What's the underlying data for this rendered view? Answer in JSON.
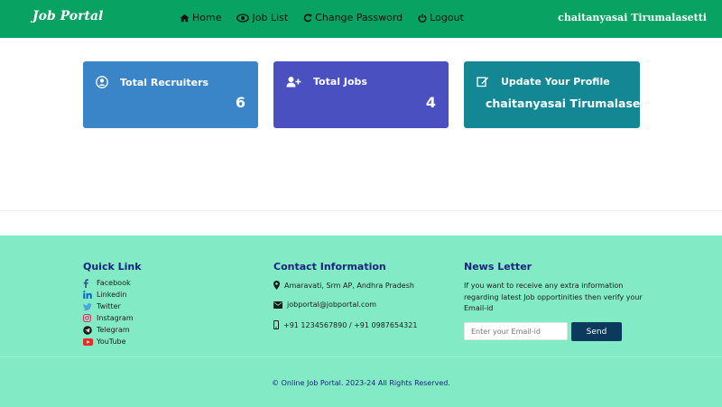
{
  "header": {
    "brand": "Job Portal",
    "nav": [
      {
        "label": "Home",
        "icon": "home-icon"
      },
      {
        "label": "Job List",
        "icon": "eye-icon"
      },
      {
        "label": "Change Password",
        "icon": "refresh-icon"
      },
      {
        "label": "Logout",
        "icon": "power-icon"
      }
    ],
    "user_name": "chaitanyasai Tirumalasetti"
  },
  "cards": {
    "recruiters": {
      "label": "Total Recruiters",
      "value": "6",
      "icon": "user-circle-icon",
      "color": "#3a85c8"
    },
    "jobs": {
      "label": "Total Jobs",
      "value": "4",
      "icon": "user-plus-icon",
      "color": "#4a50bf"
    },
    "profile": {
      "label": "Update Your Profile",
      "name": "chaitanyasai Tirumalasetti",
      "icon": "edit-icon",
      "color": "#138794"
    }
  },
  "footer": {
    "quick_link": {
      "title": "Quick Link",
      "items": [
        {
          "label": "Facebook",
          "icon": "facebook-icon"
        },
        {
          "label": "Linkedin",
          "icon": "linkedin-icon"
        },
        {
          "label": "Twitter",
          "icon": "twitter-icon"
        },
        {
          "label": "Instagram",
          "icon": "instagram-icon"
        },
        {
          "label": "Telegram",
          "icon": "telegram-icon"
        },
        {
          "label": "YouTube",
          "icon": "youtube-icon"
        }
      ]
    },
    "contact": {
      "title": "Contact Information",
      "address": "Amaravati, Srm AP, Andhra Pradesh",
      "email": "jobportal@jobportal.com",
      "phone": "+91 1234567890 / +91 0987654321"
    },
    "newsletter": {
      "title": "News Letter",
      "text": "If you want to receive any extra information regarding latest Job opportinities then verify your Email-id",
      "placeholder": "Enter your Email-id",
      "button": "Send"
    },
    "copyright": "© Online Job Portal. 2023-24 All Rights Reserved."
  }
}
